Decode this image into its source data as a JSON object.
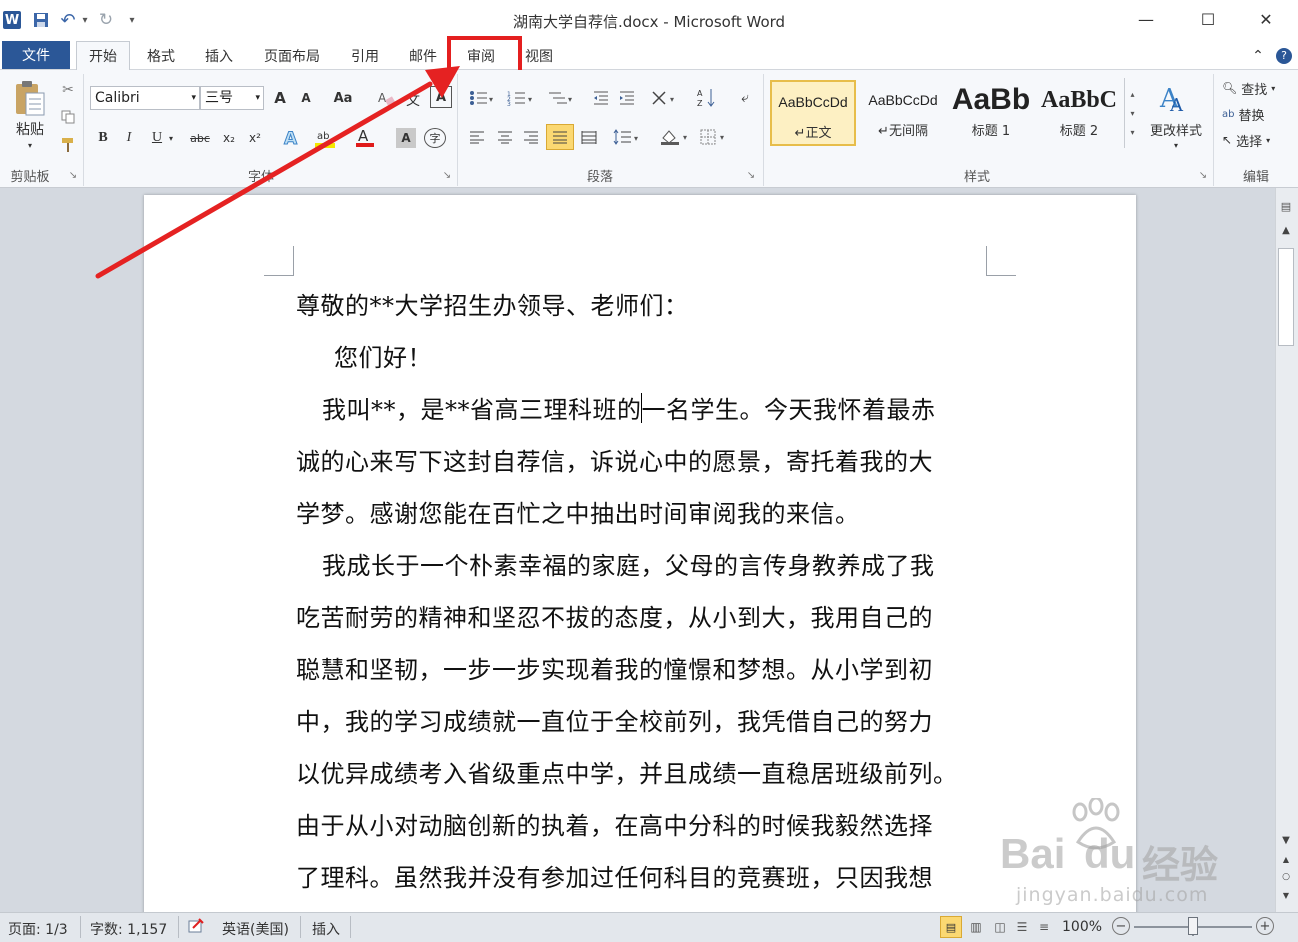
{
  "titlebar": {
    "title": "湖南大学自荐信.docx - Microsoft Word",
    "app_icon": "W",
    "undo_arrow": "↶",
    "redo_arrow": "↻",
    "qat_more": "▾",
    "min": "—",
    "max": "☐",
    "close": "✕"
  },
  "tabs": {
    "file": "文件",
    "home": "开始",
    "format": "格式",
    "insert": "插入",
    "layout": "页面布局",
    "references": "引用",
    "mailings": "邮件",
    "review": "审阅",
    "view": "视图"
  },
  "ribbon_right": {
    "collapse": "⌃",
    "help": "?"
  },
  "clipboard": {
    "paste": "粘贴",
    "label": "剪贴板"
  },
  "font": {
    "name": "Calibri",
    "size": "三号",
    "label": "字体",
    "grow": "A",
    "shrink": "A",
    "case": "Aa",
    "bold": "B",
    "italic": "I",
    "underline": "U",
    "strike": "abc",
    "sub": "x₂",
    "sup": "x²",
    "color_a": "A",
    "char_shade": "A",
    "enclose": "字"
  },
  "paragraph": {
    "label": "段落"
  },
  "styles": {
    "label": "样式",
    "items": [
      {
        "sample": "AaBbCcDd",
        "name": "↵正文"
      },
      {
        "sample": "AaBbCcDd",
        "name": "↵无间隔"
      },
      {
        "sample": "AaBb",
        "name": "标题 1"
      },
      {
        "sample": "AaBbC",
        "name": "标题 2"
      }
    ],
    "change": "更改样式"
  },
  "editing": {
    "find": "查找",
    "replace": "替换",
    "select": "选择",
    "label": "编辑"
  },
  "document": {
    "lines": [
      "尊敬的**大学招生办领导、老师们：",
      "您们好！",
      "我叫**，是**省高三理科班的一名学生。今天我怀着最赤",
      "诚的心来写下这封自荐信，诉说心中的愿景，寄托着我的大",
      "学梦。感谢您能在百忙之中抽出时间审阅我的来信。",
      "我成长于一个朴素幸福的家庭，父母的言传身教养成了我",
      "吃苦耐劳的精神和坚忍不拔的态度，从小到大，我用自己的",
      "聪慧和坚韧，一步一步实现着我的憧憬和梦想。从小学到初",
      "中，我的学习成绩就一直位于全校前列，我凭借自己的努力",
      "以优异成绩考入省级重点中学，并且成绩一直稳居班级前列。",
      "由于从小对动脑创新的执着，在高中分科的时候我毅然选择",
      "了理科。虽然我并没有参加过任何科目的竞赛班，只因我想"
    ]
  },
  "statusbar": {
    "page": "页面: 1/3",
    "words": "字数: 1,157",
    "language": "英语(美国)",
    "mode": "插入",
    "zoom": "100%",
    "zoom_minus": "−",
    "zoom_plus": "+"
  },
  "watermark": {
    "brand": "Bai",
    "brand2": "du",
    "jy": "经验",
    "url": "jingyan.baidu.com"
  },
  "colors": {
    "accent": "#2b5797",
    "highlight_red": "#e41f1f",
    "arrow_red": "#e52222"
  }
}
